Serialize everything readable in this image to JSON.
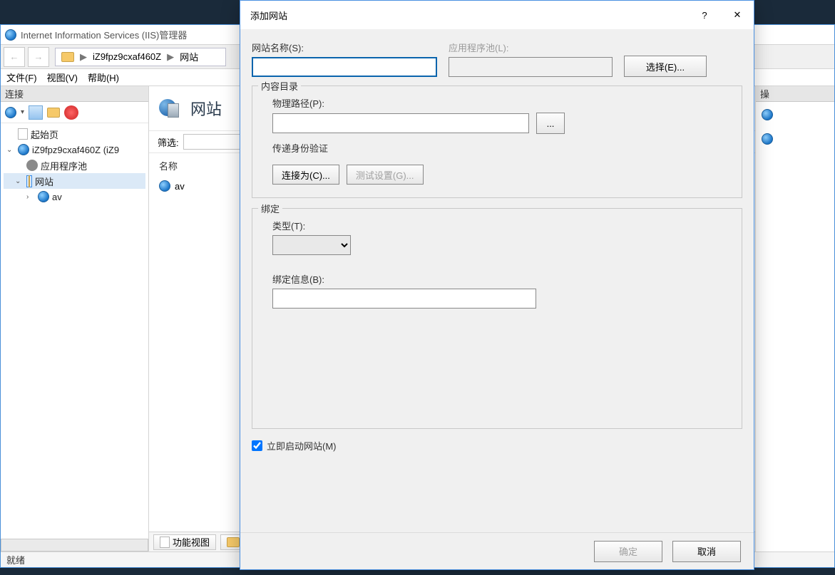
{
  "top_dark_strip": true,
  "iis": {
    "title": "Internet Information Services (IIS)管理器",
    "nav_back": "←",
    "nav_fwd": "→",
    "breadcrumb_host": "iZ9fpz9cxaf460Z",
    "breadcrumb_sep": "▶",
    "breadcrumb_item": "网站",
    "menu": {
      "file": "文件(F)",
      "view": "视图(V)",
      "help": "帮助(H)"
    },
    "left_panel_title": "连接",
    "tree": {
      "start_page": "起始页",
      "host_node": "iZ9fpz9cxaf460Z (iZ9",
      "app_pools": "应用程序池",
      "sites": "网站",
      "site_item": "av"
    },
    "middle": {
      "heading": "网站",
      "filter_label": "筛选:",
      "col_name": "名称",
      "row_site": "av",
      "tab_features": "功能视图",
      "tab_content_prefix": ""
    },
    "right_panel_title": "操",
    "status": "就绪"
  },
  "dialog": {
    "title": "添加网站",
    "help_icon": "?",
    "close_icon": "✕",
    "site_name_label": "网站名称(S):",
    "app_pool_label": "应用程序池(L):",
    "select_btn": "选择(E)...",
    "content_group": "内容目录",
    "phys_path_label": "物理路径(P):",
    "browse_btn": "...",
    "passthrough_label": "传递身份验证",
    "connect_as_btn": "连接为(C)...",
    "test_settings_btn": "测试设置(G)...",
    "binding_group": "绑定",
    "type_label": "类型(T):",
    "binding_info_label": "绑定信息(B):",
    "autostart_label": "立即启动网站(M)",
    "autostart_checked": true,
    "ok_btn": "确定",
    "cancel_btn": "取消"
  }
}
